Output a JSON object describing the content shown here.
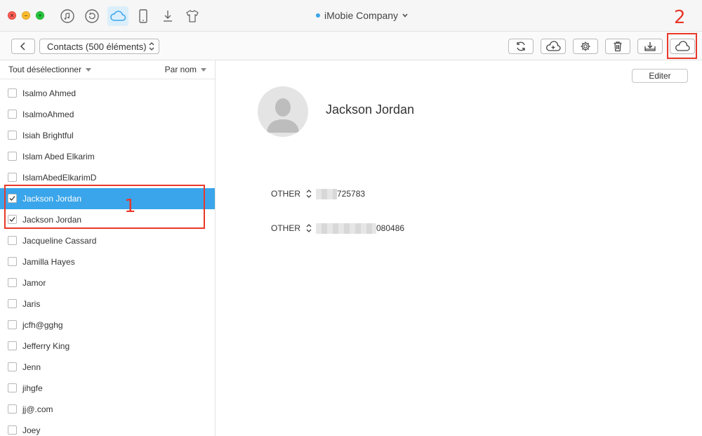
{
  "window": {
    "device_name": "iMobie Company",
    "device_dot_color": "#3aa5ea",
    "top_icons": [
      "music-icon",
      "restore-icon",
      "icloud-icon",
      "phone-icon",
      "download-icon",
      "shirt-icon"
    ],
    "active_top_icon": "icloud-icon"
  },
  "toolbar": {
    "category_selector": "Contacts (500 éléments)",
    "tools": [
      "refresh-icon",
      "cloud-upload-icon",
      "settings-icon",
      "trash-icon",
      "export-icon",
      "icloud-icon"
    ]
  },
  "annotations": {
    "step1": "1",
    "step2": "2",
    "color": "#e8382a"
  },
  "list": {
    "header_left": "Tout désélectionner",
    "header_right": "Par nom",
    "items": [
      {
        "name": "Isalmo Ahmed",
        "checked": false,
        "selected": false
      },
      {
        "name": "IsalmoAhmed",
        "checked": false,
        "selected": false
      },
      {
        "name": "Isiah Brightful",
        "checked": false,
        "selected": false
      },
      {
        "name": "Islam Abed Elkarim",
        "checked": false,
        "selected": false
      },
      {
        "name": "IslamAbedElkarimD",
        "checked": false,
        "selected": false
      },
      {
        "name": "Jackson Jordan",
        "checked": true,
        "selected": true
      },
      {
        "name": "Jackson Jordan",
        "checked": true,
        "selected": false
      },
      {
        "name": "Jacqueline Cassard",
        "checked": false,
        "selected": false
      },
      {
        "name": "Jamilla Hayes",
        "checked": false,
        "selected": false
      },
      {
        "name": "Jamor",
        "checked": false,
        "selected": false
      },
      {
        "name": "Jaris",
        "checked": false,
        "selected": false
      },
      {
        "name": "jcfh@gghg",
        "checked": false,
        "selected": false
      },
      {
        "name": "Jefferry King",
        "checked": false,
        "selected": false
      },
      {
        "name": "Jenn",
        "checked": false,
        "selected": false
      },
      {
        "name": "jihgfe",
        "checked": false,
        "selected": false
      },
      {
        "name": "jj@.com",
        "checked": false,
        "selected": false
      },
      {
        "name": "Joey",
        "checked": false,
        "selected": false
      }
    ],
    "selected_color": "#3aa5ea"
  },
  "detail": {
    "edit_label": "Editer",
    "contact_name": "Jackson  Jordan",
    "fields": [
      {
        "label": "OTHER",
        "value_suffix": "725783"
      },
      {
        "label": "OTHER",
        "value_suffix": "080486"
      }
    ]
  }
}
